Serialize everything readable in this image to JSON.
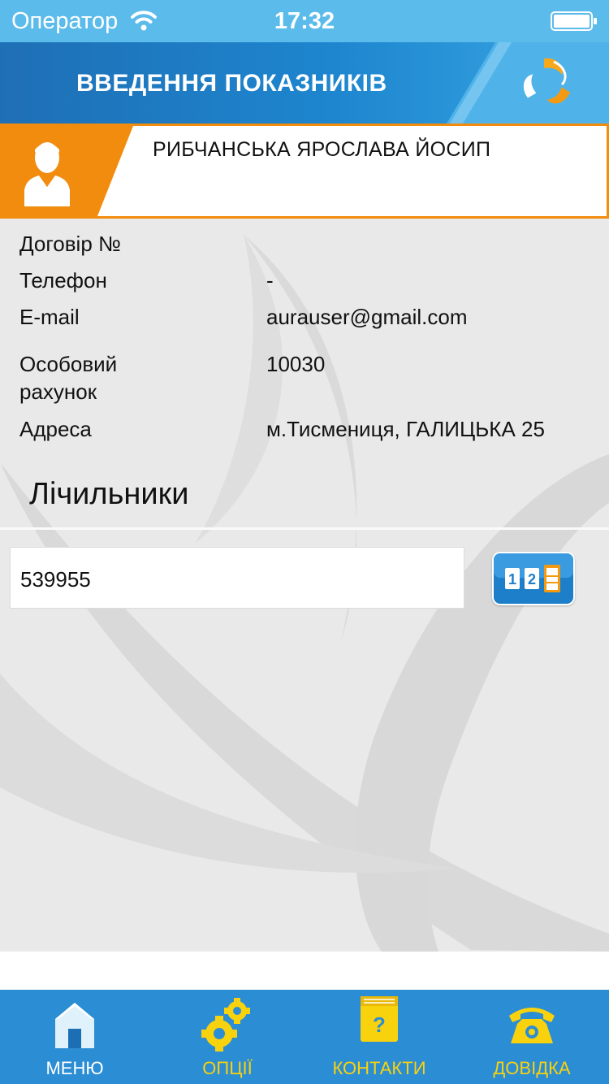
{
  "status_bar": {
    "carrier": "Оператор",
    "time": "17:32"
  },
  "header": {
    "title": "ВВЕДЕННЯ ПОКАЗНИКІВ"
  },
  "user": {
    "name": "РИБЧАНСЬКА ЯРОСЛАВА ЙОСИП"
  },
  "info": {
    "contract_label": "Договір №",
    "contract_value": "",
    "phone_label": "Телефон",
    "phone_value": "-",
    "email_label": "E-mail",
    "email_value": "aurauser@gmail.com",
    "account_label_line1": "Особовий",
    "account_label_line2": "рахунок",
    "account_value": "10030",
    "address_label": "Адреса",
    "address_value": "м.Тисмениця, ГАЛИЦЬКА 25"
  },
  "meters": {
    "title": "Лічильники",
    "items": [
      {
        "number": "539955"
      }
    ]
  },
  "tabs": {
    "menu": "МЕНЮ",
    "options": "ОПЦІЇ",
    "contacts": "КОНТАКТИ",
    "help": "ДОВІДКА"
  },
  "colors": {
    "status_bar": "#5bbbeb",
    "header_blue": "#1d86cf",
    "accent_orange": "#f28c0e",
    "tab_bar": "#2b8dd3",
    "tab_active_yellow": "#f9d20e"
  }
}
